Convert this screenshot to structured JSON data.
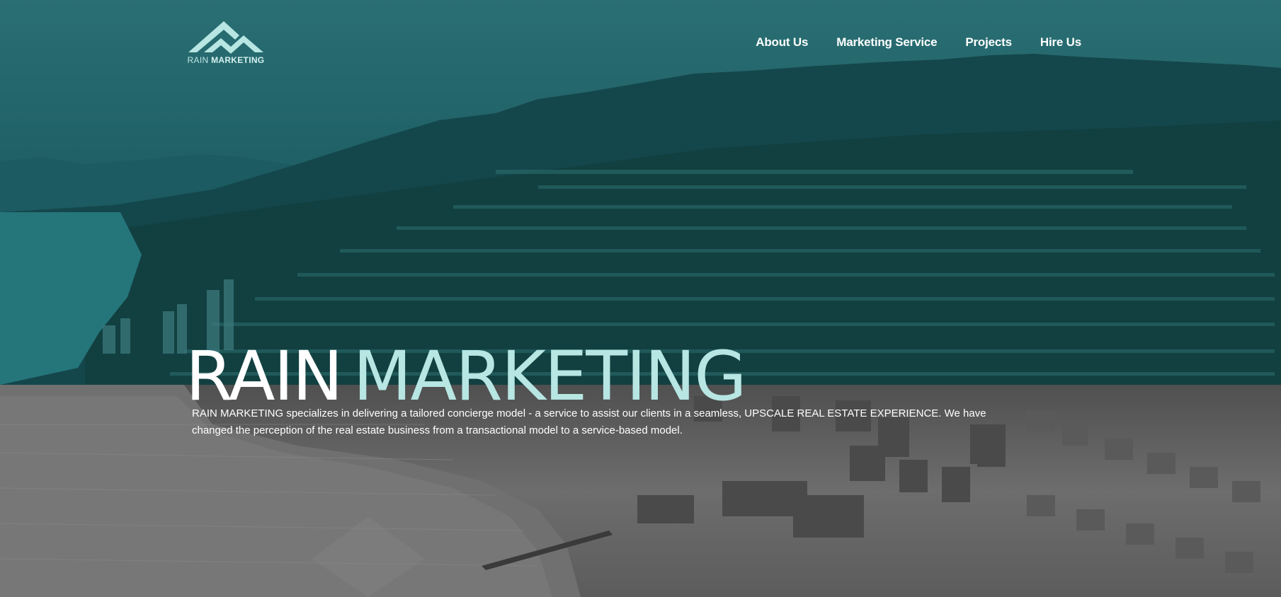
{
  "brand": {
    "logo_word1": "RAIN",
    "logo_word2": "MARKETING",
    "accent_color": "#b7e6e3",
    "overlay_color": "#1f6166"
  },
  "nav": {
    "items": [
      {
        "label": "About Us"
      },
      {
        "label": "Marketing Service"
      },
      {
        "label": "Projects"
      },
      {
        "label": "Hire Us"
      }
    ]
  },
  "hero": {
    "title_word1": "RAIN",
    "title_word2": "MARKETING",
    "description": "RAIN MARKETING specializes in delivering a tailored concierge model - a service to assist our clients in a seamless, UPSCALE REAL ESTATE EXPERIENCE. We have changed the perception of the real estate business from a transactional model to a service-based model."
  },
  "icons": {
    "logo": "mountain-logo-icon",
    "background": "city-aerial-background"
  }
}
